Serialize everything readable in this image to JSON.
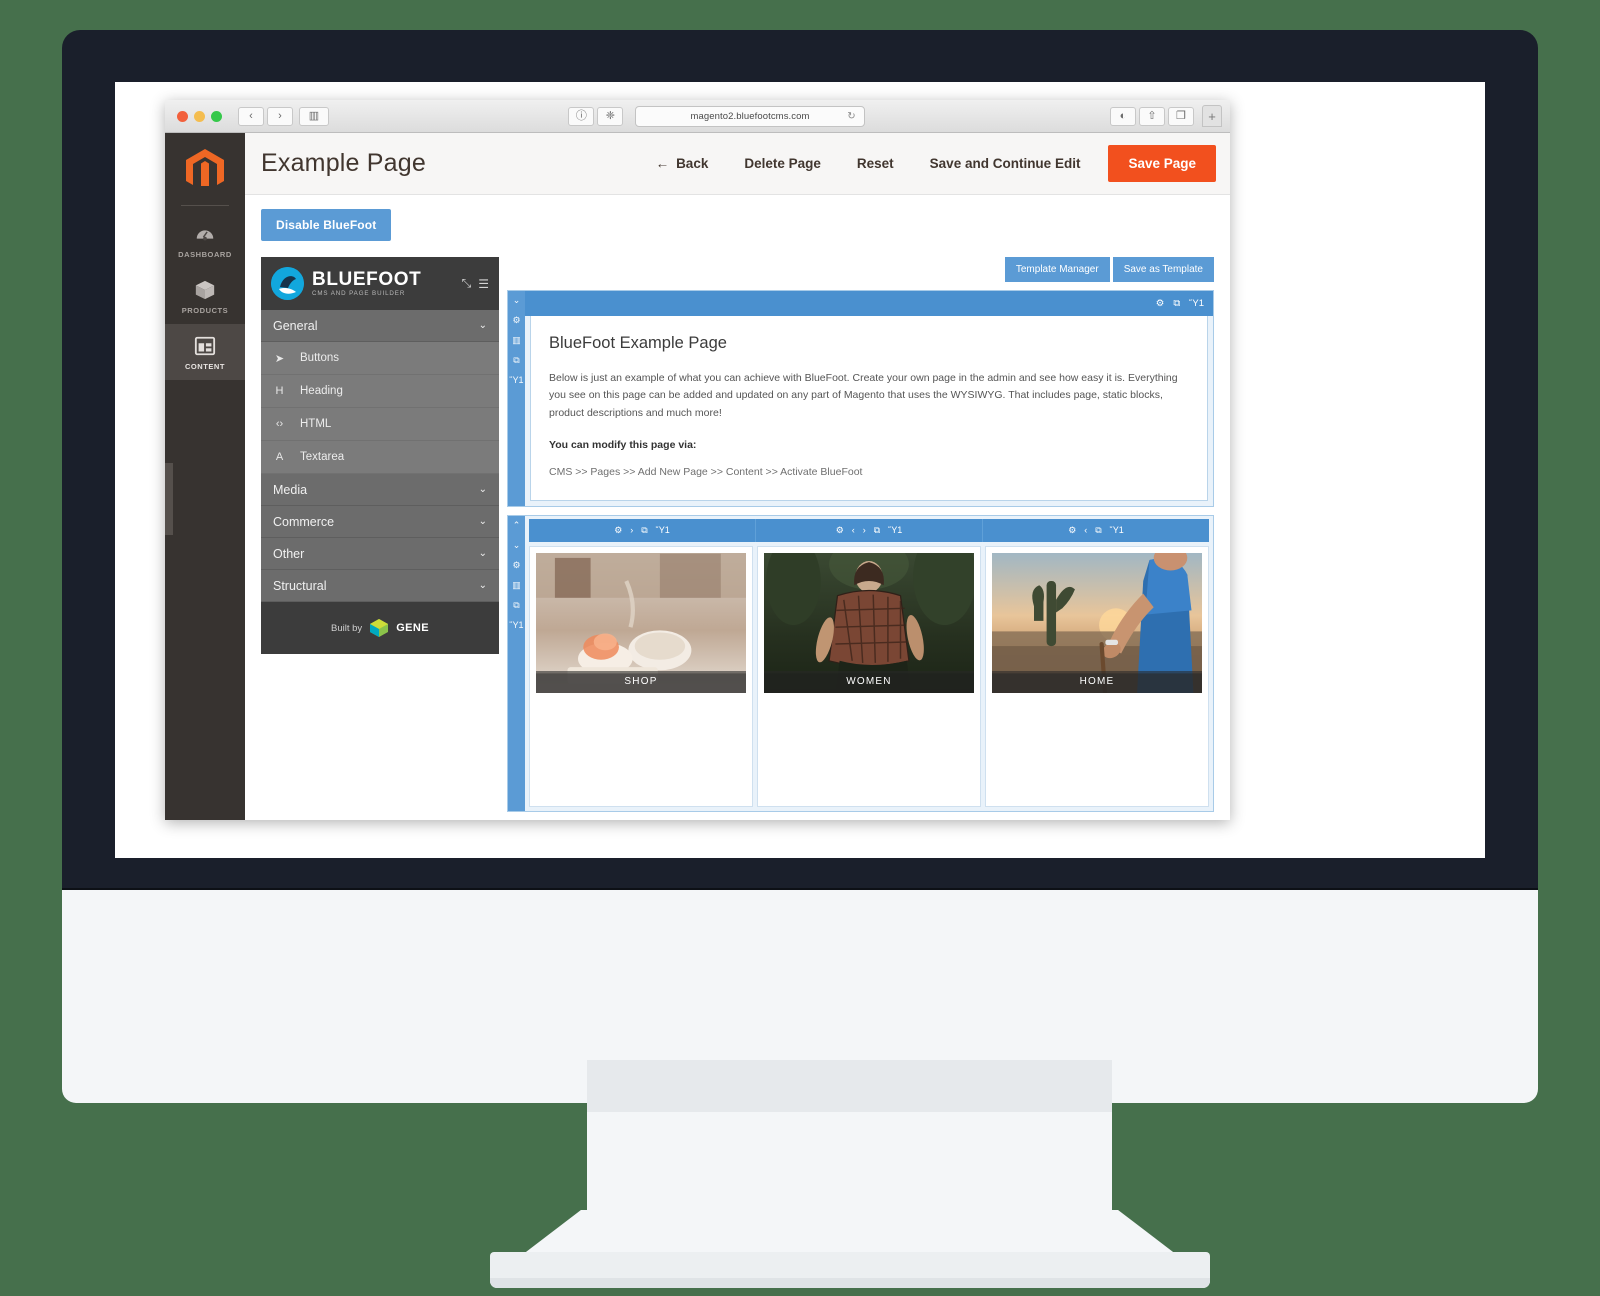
{
  "browser": {
    "url": "magento2.bluefootcms.com",
    "reload_icon": "reload-icon",
    "back_icon": "‹",
    "forward_icon": "›",
    "sidebar_icon": "▥",
    "info_icon": "ⓘ",
    "shield_icon": "❈",
    "reader_icon": "◐",
    "share_icon": "⇧",
    "tabs_icon": "❐",
    "new_tab_icon": "+",
    "reload_glyph": "↻"
  },
  "magento_sidebar": {
    "logo_name": "magento-logo",
    "items": [
      {
        "label": "DASHBOARD",
        "icon": "gauge-icon",
        "active": false
      },
      {
        "label": "PRODUCTS",
        "icon": "box-icon",
        "active": false
      },
      {
        "label": "CONTENT",
        "icon": "layout-icon",
        "active": true
      }
    ]
  },
  "page_header": {
    "title": "Example Page",
    "back": "Back",
    "back_arrow": "←",
    "delete_page": "Delete Page",
    "reset": "Reset",
    "save_continue": "Save and Continue Edit",
    "save_page": "Save Page",
    "save_page_color": "#f2501e"
  },
  "toolbar": {
    "disable_bluefoot": "Disable BlueFoot",
    "template_manager": "Template Manager",
    "save_as_template": "Save as Template",
    "accent_blue": "#5b9bd5"
  },
  "bluefoot_panel": {
    "title": "BLUEFOOT",
    "subtitle": "CMS AND PAGE BUILDER",
    "expand_icon": "⤡",
    "menu_icon": "☰",
    "groups": [
      {
        "label": "General",
        "chevron": "⌄",
        "expanded": true,
        "items": [
          {
            "label": "Buttons",
            "icon": "cursor-icon",
            "glyph": "➤"
          },
          {
            "label": "Heading",
            "icon": "heading-icon",
            "glyph": "H"
          },
          {
            "label": "HTML",
            "icon": "code-icon",
            "glyph": "‹›"
          },
          {
            "label": "Textarea",
            "icon": "text-icon",
            "glyph": "A"
          }
        ]
      },
      {
        "label": "Media",
        "chevron": "⌄",
        "expanded": false,
        "items": []
      },
      {
        "label": "Commerce",
        "chevron": "⌄",
        "expanded": false,
        "items": []
      },
      {
        "label": "Other",
        "chevron": "⌄",
        "expanded": false,
        "items": []
      },
      {
        "label": "Structural",
        "chevron": "⌄",
        "expanded": false,
        "items": []
      }
    ],
    "footer": {
      "built_by": "Built by",
      "brand": "GENE"
    }
  },
  "content_block": {
    "rail_icons": [
      "⌄",
      "⚙",
      "▥",
      "⧉",
      "Ὕ1"
    ],
    "titlebar_icons": [
      "gear-icon",
      "duplicate-icon",
      "trash-icon"
    ],
    "titlebar_glyphs": [
      "⚙",
      "⧉",
      "Ὕ1"
    ],
    "heading": "BlueFoot Example Page",
    "paragraph": "Below is just an example of what you can achieve with BlueFoot.  Create your own page in the admin and see how easy it is. Everything you see on this page can be added and updated on any part of Magento that uses the WYSIWYG. That includes page, static blocks, product descriptions and much more!",
    "modify_label": "You can modify this page via:",
    "path": "CMS >> Pages >> Add New Page >> Content >> Activate BlueFoot"
  },
  "cards_block": {
    "rail_icons": [
      "⌃",
      "⌄",
      "⚙",
      "▥",
      "⧉",
      "Ὕ1"
    ],
    "cards": [
      {
        "caption": "SHOP",
        "image": "coffee-book-photo",
        "toolbar_glyphs": [
          "⚙",
          "›",
          "⧉",
          "Ὕ1"
        ]
      },
      {
        "caption": "WOMEN",
        "image": "woman-forest-photo",
        "toolbar_glyphs": [
          "⚙",
          "‹",
          "›",
          "⧉",
          "Ὕ1"
        ]
      },
      {
        "caption": "HOME",
        "image": "desert-cactus-photo",
        "toolbar_glyphs": [
          "⚙",
          "‹",
          "⧉",
          "Ὕ1"
        ]
      }
    ]
  }
}
